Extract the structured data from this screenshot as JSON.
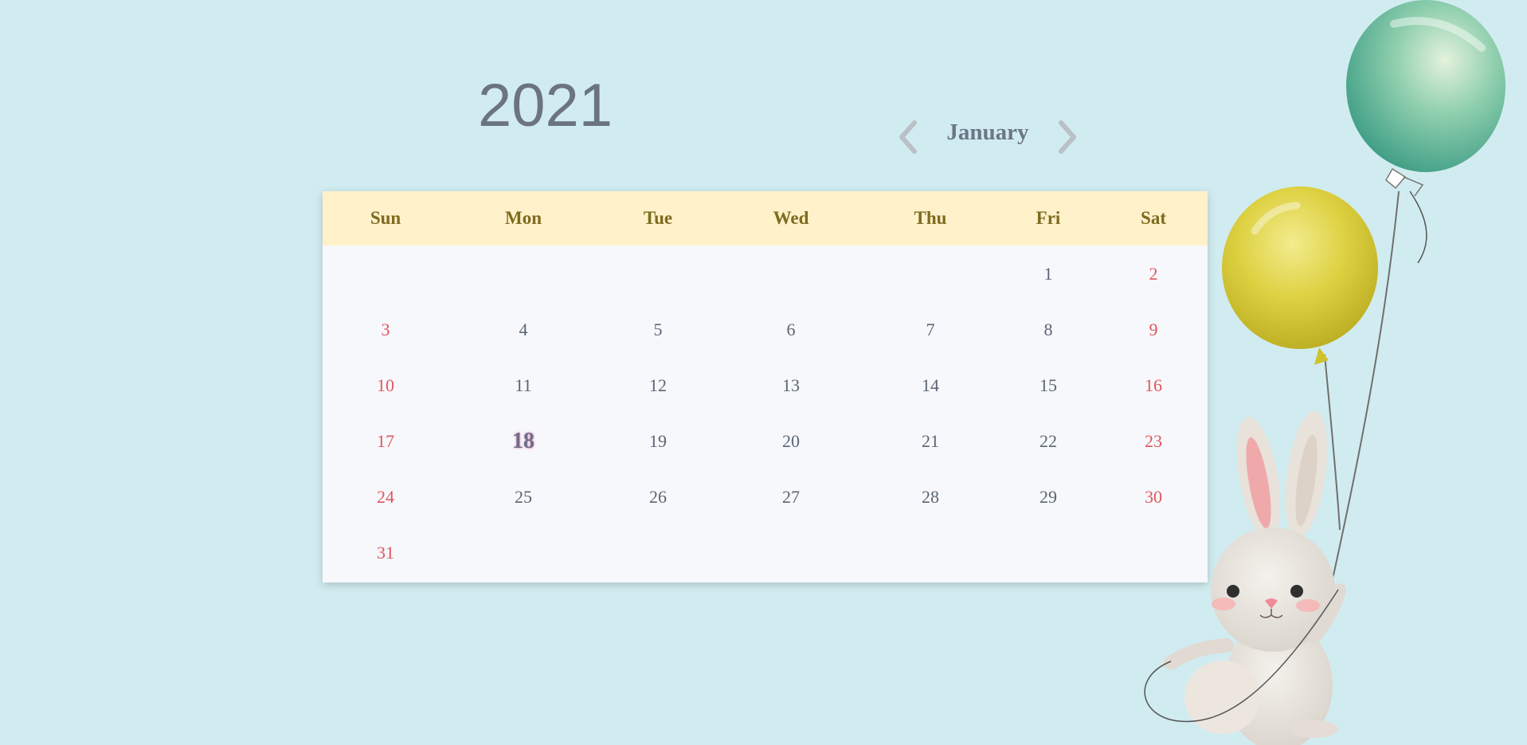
{
  "header": {
    "year": "2021",
    "month": "January",
    "prev_icon": "chevron-left-icon",
    "next_icon": "chevron-right-icon"
  },
  "calendar": {
    "weekdays": [
      "Sun",
      "Mon",
      "Tue",
      "Wed",
      "Thu",
      "Fri",
      "Sat"
    ],
    "rows": [
      [
        "",
        "",
        "",
        "",
        "",
        "1",
        "2"
      ],
      [
        "3",
        "4",
        "5",
        "6",
        "7",
        "8",
        "9"
      ],
      [
        "10",
        "11",
        "12",
        "13",
        "14",
        "15",
        "16"
      ],
      [
        "17",
        "18",
        "19",
        "20",
        "21",
        "22",
        "23"
      ],
      [
        "24",
        "25",
        "26",
        "27",
        "28",
        "29",
        "30"
      ],
      [
        "31",
        "",
        "",
        "",
        "",
        "",
        ""
      ]
    ],
    "today": "18"
  },
  "colors": {
    "background": "#d1ecf0",
    "header_band": "#fff1c9",
    "weekday_text": "#7e6a1e",
    "weekend_text": "#e0565e",
    "day_text": "#5b6573",
    "today_glow": "#f1a9c6"
  },
  "illustration": {
    "icons": [
      "green-balloon-icon",
      "yellow-balloon-icon",
      "bunny-icon"
    ]
  }
}
